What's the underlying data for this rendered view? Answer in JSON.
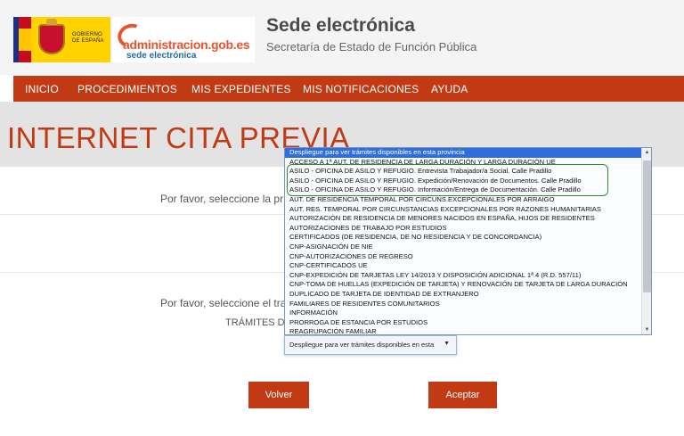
{
  "header": {
    "gob_logo_text": [
      "GOBIERNO",
      "DE ESPAÑA"
    ],
    "admin_logo_main": "administracion.gob.es",
    "admin_logo_sub": "sede electrónica",
    "site_title": "Sede electrónica",
    "site_subtitle": "Secretaría de Estado de Función Pública"
  },
  "nav": {
    "items": [
      "INICIO",
      "PROCEDIMIENTOS",
      "MIS EXPEDIENTES",
      "MIS NOTIFICACIONES",
      "AYUDA"
    ]
  },
  "page_title": "INTERNET CITA PREVIA",
  "main": {
    "prompt1": "Por favor, seleccione la pr",
    "prompt2": "Por favor, seleccione el tra",
    "tramites_label": "TRÁMITES DI",
    "select_value": "Despliegue para ver trámites disponibles en esta"
  },
  "dropdown": {
    "selected_index": 0,
    "highlighted_rows": [
      2,
      3,
      4
    ],
    "options": [
      "Despliegue para ver trámites disponibles en esta provincia",
      "ACCESO A 1ª AUT. DE RESIDENCIA DE LARGA DURACIÓN Y LARGA DURACIÓN UE",
      "ASILO - OFICINA DE ASILO Y REFUGIO. Entrevista Trabajador/a Social. Calle Pradillo",
      "ASILO - OFICINA DE ASILO Y REFUGIO. Expedición/Renovación de Documentos. Calle Pradillo",
      "ASILO - OFICINA DE ASILO Y REFUGIO. Información/Entrega de Documentación. Calle Pradillo",
      "AUT. DE RESIDENCIA TEMPORAL POR CIRCUNS.EXCEPCIONALES POR ARRAIGO",
      "AUT. RES. TEMPORAL POR CIRCUNSTANCIAS EXCEPCIONALES POR RAZONES HUMANITARIAS",
      "AUTORIZACIÓN DE RESIDENCIA DE MENORES NACIDOS EN ESPAÑA, HIJOS DE RESIDENTES",
      "AUTORIZACIONES DE TRABAJO POR ESTUDIOS",
      "CERTIFICADOS (DE RESIDENCIA, DE NO RESIDENCIA Y DE CONCORDANCIA)",
      "CNP-ASIGNACIÓN DE NIE",
      "CNP-AUTORIZACIONES DE REGRESO",
      "CNP-CERTIFICADOS UE",
      "CNP-EXPEDICIÓN DE TARJETAS LEY 14/2013 Y DISPOSICIÓN ADICIONAL 1ª.4 (R.D. 557/11)",
      "CNP-TOMA DE HUELLAS (EXPEDICIÓN DE TARJETA) Y RENOVACIÓN DE TARJETA DE LARGA DURACIÓN",
      "DUPLICADO DE TARJETA DE IDENTIDAD DE EXTRANJERO",
      "FAMILIARES DE RESIDENTES COMUNITARIOS",
      "INFORMACIÓN",
      "PRORROGA DE ESTANCIA POR ESTUDIOS",
      "REAGRUPACIÓN FAMILIAR"
    ]
  },
  "buttons": {
    "back": "Volver",
    "accept": "Aceptar"
  },
  "colors": {
    "brand": "#c23a14",
    "highlight": "#2f8f2f",
    "selection": "#2e6ddd"
  }
}
